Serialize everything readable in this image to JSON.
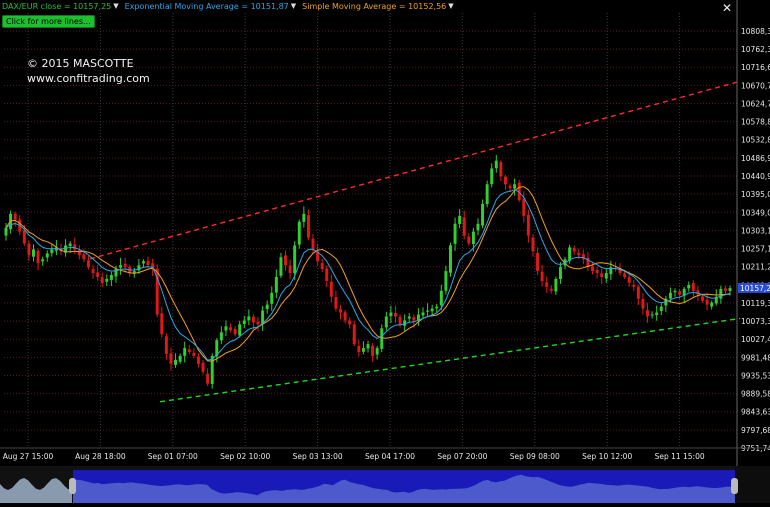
{
  "legend": {
    "close_label": "DAX/EUR close = 10157,25",
    "ema_label": "Exponential Moving Average = 10151,87",
    "sma_label": "Simple Moving Average = 10152,56",
    "close_color": "#27c22f",
    "ema_color": "#29a8e8",
    "sma_color": "#f0a020"
  },
  "more_lines_label": "Click for more lines...",
  "copyright": {
    "line1": "© 2015 MASCOTTE",
    "line2": "www.confitrading.com"
  },
  "close_icon": "close-icon",
  "chart_data": {
    "type": "candlestick",
    "title": "",
    "ylim": [
      9751.74,
      10854.0
    ],
    "y_ticks": [
      "10808,34",
      "10762,39",
      "10716,64",
      "10670,70",
      "10624,75",
      "10578,80",
      "10532,85",
      "10486,90",
      "10440,96",
      "10395,01",
      "10349,06",
      "10303,11",
      "10257,16",
      "10211,22",
      "10163,27",
      "10119,32",
      "10073,37",
      "10027,42",
      "9981,48",
      "9935,53",
      "9889,58",
      "9843,63",
      "9797,68",
      "9751,74"
    ],
    "current_price_label": "10157,25",
    "x_labels": [
      "Aug 27 15:00",
      "Aug 28 18:00",
      "Sep 01 07:00",
      "Sep 02 10:00",
      "Sep 03 13:00",
      "Sep 04 17:00",
      "Sep 07 20:00",
      "Sep 09 08:00",
      "Sep 10 12:00",
      "Sep 11 15:00"
    ],
    "close": [
      10310,
      10345,
      10330,
      10300,
      10270,
      10240,
      10255,
      10220,
      10230,
      10245,
      10255,
      10260,
      10250,
      10265,
      10270,
      10255,
      10240,
      10230,
      10210,
      10195,
      10185,
      10170,
      10180,
      10190,
      10205,
      10215,
      10210,
      10195,
      10200,
      10215,
      10225,
      10215,
      10205,
      10090,
      10040,
      9990,
      9965,
      9975,
      9985,
      10005,
      9995,
      9985,
      9965,
      9945,
      9915,
      9985,
      10025,
      10045,
      10060,
      10050,
      10040,
      10065,
      10075,
      10085,
      10070,
      10065,
      10100,
      10115,
      10145,
      10185,
      10235,
      10215,
      10195,
      10265,
      10325,
      10345,
      10285,
      10255,
      10225,
      10205,
      10175,
      10135,
      10105,
      10095,
      10075,
      10065,
      10015,
      9995,
      10005,
      10015,
      9985,
      10005,
      10055,
      10085,
      10095,
      10085,
      10065,
      10075,
      10085,
      10075,
      10090,
      10095,
      10100,
      10105,
      10110,
      10150,
      10200,
      10265,
      10320,
      10340,
      10290,
      10270,
      10300,
      10320,
      10370,
      10420,
      10460,
      10480,
      10440,
      10420,
      10410,
      10420,
      10380,
      10340,
      10290,
      10250,
      10200,
      10175,
      10160,
      10150,
      10180,
      10210,
      10230,
      10260,
      10250,
      10240,
      10230,
      10210,
      10200,
      10195,
      10185,
      10195,
      10210,
      10205,
      10195,
      10185,
      10170,
      10160,
      10130,
      10105,
      10085,
      10090,
      10095,
      10110,
      10130,
      10145,
      10150,
      10140,
      10155,
      10165,
      10150,
      10140,
      10125,
      10115,
      10120,
      10135,
      10155,
      10150,
      10157
    ],
    "ema_name": "Exponential Moving Average",
    "sma_name": "Simple Moving Average",
    "channel_upper": {
      "from": [
        90,
        10231
      ],
      "to": [
        740,
        10681
      ]
    },
    "channel_lower": {
      "from": [
        160,
        9869
      ],
      "to": [
        740,
        10080
      ]
    },
    "upper_color": "#ff2a2a",
    "lower_color": "#20d820",
    "grid": true
  }
}
